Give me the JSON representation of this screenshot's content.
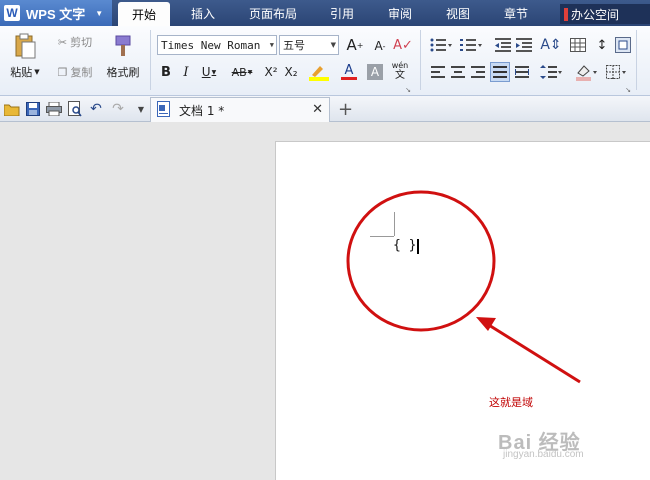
{
  "app": {
    "title": "WPS 文字",
    "logo": "W"
  },
  "menu": {
    "tabs": [
      "开始",
      "插入",
      "页面布局",
      "引用",
      "审阅",
      "视图",
      "章节"
    ],
    "office": "办公空间"
  },
  "ribbon": {
    "paste": "粘贴",
    "cut": "剪切",
    "copy": "复制",
    "format_painter": "格式刷",
    "font_name": "Times New Roman",
    "font_size": "五号",
    "bold": "B",
    "italic": "I",
    "underline": "U",
    "strikethrough": "AB",
    "superscript": "X²",
    "subscript": "X₂",
    "font_color": "A",
    "char_shade": "A",
    "pinyin_top": "wén",
    "pinyin_bottom": "文",
    "grow_font": "A",
    "shrink_font": "A"
  },
  "document_tab": {
    "title": "文档 1 *",
    "close": "✕",
    "new_tab": "+"
  },
  "document": {
    "field_code": "{ }"
  },
  "annotation": {
    "label": "这就是域",
    "color": "#c00000"
  },
  "watermark": {
    "brand": "Bai 经验",
    "url": "jingyan.baidu.com"
  },
  "colors": {
    "menubar": "#2b4575",
    "accent": "#3a6ab8",
    "annotation": "#d01010"
  }
}
